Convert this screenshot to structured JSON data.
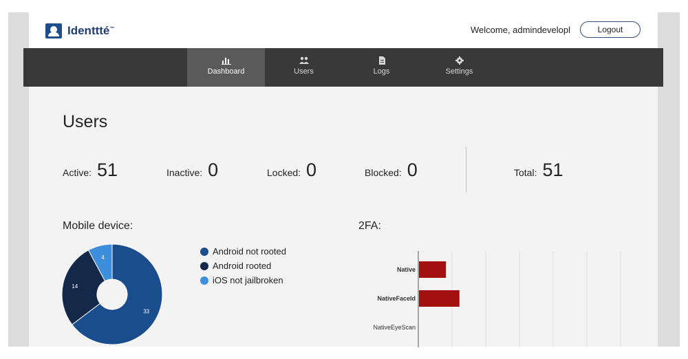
{
  "app": {
    "name": "Identtté",
    "trademark": "™"
  },
  "header": {
    "welcome": "Welcome, admindevelopl",
    "logout_label": "Logout"
  },
  "nav": [
    {
      "label": "Dashboard",
      "icon": "bar-chart-icon",
      "active": true
    },
    {
      "label": "Users",
      "icon": "users-icon",
      "active": false
    },
    {
      "label": "Logs",
      "icon": "document-icon",
      "active": false
    },
    {
      "label": "Settings",
      "icon": "gear-icon",
      "active": false
    }
  ],
  "users": {
    "title": "Users",
    "stats": [
      {
        "label": "Active:",
        "value": "51"
      },
      {
        "label": "Inactive:",
        "value": "0"
      },
      {
        "label": "Locked:",
        "value": "0"
      },
      {
        "label": "Blocked:",
        "value": "0"
      },
      {
        "label": "Total:",
        "value": "51"
      }
    ]
  },
  "mobile": {
    "title": "Mobile device:",
    "legend": [
      {
        "label": "Android not rooted",
        "color": "#1a4d8c"
      },
      {
        "label": "Android rooted",
        "color": "#14284a"
      },
      {
        "label": "iOS not jailbroken",
        "color": "#3d8fdc"
      }
    ]
  },
  "twofa": {
    "title": "2FA:"
  },
  "chart_data": [
    {
      "type": "pie",
      "categories": [
        "Android not rooted",
        "Android rooted",
        "iOS not jailbroken"
      ],
      "values": [
        33,
        14,
        4
      ],
      "colors": [
        "#1a4d8c",
        "#14284a",
        "#3d8fdc"
      ],
      "legend": "right"
    },
    {
      "type": "bar",
      "orientation": "horizontal",
      "categories": [
        "Native",
        "NativeFaceId",
        "NativeEyeScan"
      ],
      "values": [
        8,
        12,
        0
      ],
      "xlim": [
        0,
        60
      ],
      "grid": true,
      "color": "#a31010"
    }
  ]
}
